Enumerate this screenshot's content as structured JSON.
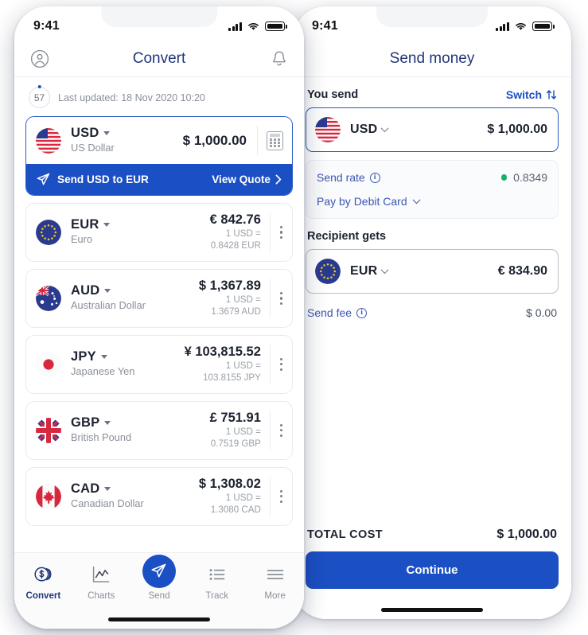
{
  "colors": {
    "brand_blue": "#1b4fc4",
    "title_navy": "#22367a",
    "link_blue": "#3a56b5",
    "green": "#17b26a",
    "muted": "#8a9099"
  },
  "left_phone": {
    "status_bar": {
      "time": "9:41",
      "signal_icon": "cellular-bars-icon",
      "wifi_icon": "wifi-icon",
      "battery_icon": "battery-icon"
    },
    "nav": {
      "profile_icon": "profile-icon",
      "title": "Convert",
      "bell_icon": "bell-icon"
    },
    "refresh": {
      "seconds": "57",
      "updated_text": "Last updated: 18 Nov 2020 10:20"
    },
    "base_card": {
      "flag": "flag-us",
      "code": "USD",
      "name": "US Dollar",
      "amount": "$ 1,000.00",
      "calculator_icon": "calculator-icon",
      "banner_label": "Send USD to EUR",
      "banner_action": "View Quote",
      "send_icon": "send-plane-icon",
      "chevron_icon": "chevron-right-icon"
    },
    "rates": [
      {
        "flag": "flag-eu",
        "code": "EUR",
        "name": "Euro",
        "amount": "€ 842.76",
        "rate_line1": "1 USD =",
        "rate_line2": "0.8428 EUR"
      },
      {
        "flag": "flag-au",
        "code": "AUD",
        "name": "Australian Dollar",
        "amount": "$ 1,367.89",
        "rate_line1": "1 USD =",
        "rate_line2": "1.3679 AUD"
      },
      {
        "flag": "flag-jp",
        "code": "JPY",
        "name": "Japanese Yen",
        "amount": "¥ 103,815.52",
        "rate_line1": "1 USD =",
        "rate_line2": "103.8155 JPY"
      },
      {
        "flag": "flag-gb",
        "code": "GBP",
        "name": "British Pound",
        "amount": "£ 751.91",
        "rate_line1": "1 USD =",
        "rate_line2": "0.7519 GBP"
      },
      {
        "flag": "flag-ca",
        "code": "CAD",
        "name": "Canadian Dollar",
        "amount": "$ 1,308.02",
        "rate_line1": "1 USD =",
        "rate_line2": "1.3080 CAD"
      }
    ],
    "tabs": [
      {
        "label": "Convert",
        "icon": "coins-dollar-icon",
        "active": true
      },
      {
        "label": "Charts",
        "icon": "line-chart-icon",
        "active": false
      },
      {
        "label": "Send",
        "icon": "send-plane-icon",
        "active": false
      },
      {
        "label": "Track",
        "icon": "list-icon",
        "active": false
      },
      {
        "label": "More",
        "icon": "hamburger-icon",
        "active": false
      }
    ]
  },
  "right_phone": {
    "status_bar": {
      "time": "9:41"
    },
    "nav": {
      "title": "Send money"
    },
    "you_send": {
      "label": "You send",
      "switch_label": "Switch",
      "switch_icon": "switch-arrows-icon",
      "flag": "flag-us",
      "code": "USD",
      "amount": "$ 1,000.00"
    },
    "rate_card": {
      "send_rate_label": "Send rate",
      "send_rate_value": "0.8349",
      "info_icon": "info-icon",
      "status_dot": "green-status-dot",
      "payment_method": "Pay by Debit Card",
      "chevron_icon": "chevron-down-icon"
    },
    "recipient": {
      "label": "Recipient gets",
      "flag": "flag-eu",
      "code": "EUR",
      "amount": "€ 834.90"
    },
    "fee": {
      "label": "Send fee",
      "value": "$ 0.00",
      "info_icon": "info-icon"
    },
    "total": {
      "label": "TOTAL COST",
      "value": "$ 1,000.00"
    },
    "cta": {
      "label": "Continue"
    }
  }
}
